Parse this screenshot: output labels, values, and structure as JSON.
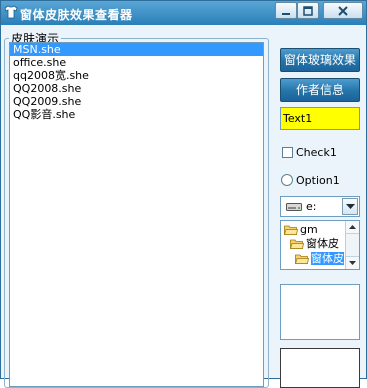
{
  "window": {
    "title": "窗体皮肤效果查看器",
    "colors": {
      "titlebar": "#3a8fc6",
      "selection": "#3399ff",
      "textbox_bg": "#ffff00"
    }
  },
  "group": {
    "label": "皮肤演示"
  },
  "skins": {
    "items": [
      "MSN.she",
      "office.she",
      "qq2008宽.she",
      "QQ2008.she",
      "QQ2009.she",
      "QQ影音.she"
    ],
    "selected_index": 0
  },
  "buttons": {
    "glass_effect": "窗体玻璃效果",
    "author_info": "作者信息"
  },
  "textbox": {
    "value": "Text1"
  },
  "checkbox": {
    "label": "Check1",
    "checked": false
  },
  "radio": {
    "label": "Option1",
    "checked": false
  },
  "drive": {
    "value": "e:"
  },
  "dirs": {
    "items": [
      "gm",
      "窗体皮",
      "窗体皮"
    ],
    "selected_index": 2
  }
}
